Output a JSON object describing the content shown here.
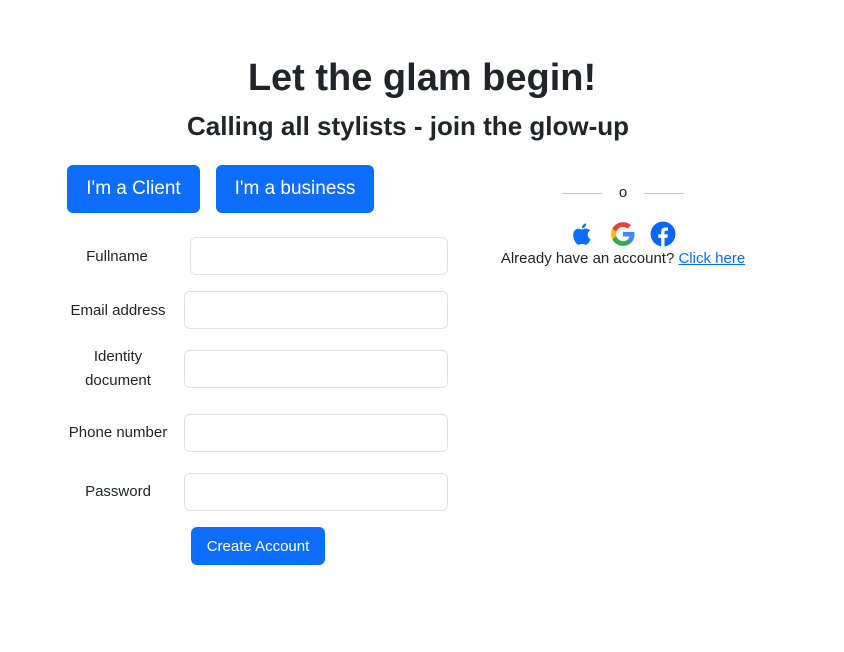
{
  "header": {
    "title": "Let the glam begin!",
    "subtitle": "Calling all stylists - join the glow-up"
  },
  "account_type": {
    "client_label": "I'm a Client",
    "business_label": "I'm a business"
  },
  "form": {
    "fullname": {
      "label": "Fullname",
      "value": "",
      "placeholder": ""
    },
    "email": {
      "label": "Email address",
      "value": "",
      "placeholder": ""
    },
    "identity": {
      "label": "Identity document",
      "value": "",
      "placeholder": ""
    },
    "phone": {
      "label": "Phone number",
      "value": "",
      "placeholder": ""
    },
    "password": {
      "label": "Password",
      "value": "",
      "placeholder": ""
    },
    "submit_label": "Create Account"
  },
  "social": {
    "divider_text": "o",
    "icons": [
      "apple-icon",
      "google-icon",
      "facebook-icon"
    ],
    "login_prompt": "Already have an account?",
    "login_link": "Click here"
  },
  "colors": {
    "primary": "#0d6efd",
    "text": "#212529",
    "input_border": "#dee2e6",
    "facebook": "#0866ff",
    "apple": "#0d6efd"
  }
}
